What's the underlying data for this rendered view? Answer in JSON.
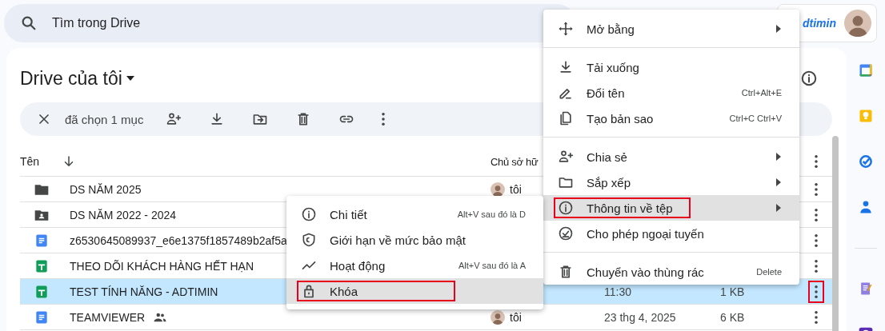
{
  "search": {
    "placeholder": "Tìm trong Drive"
  },
  "account": {
    "logo_text": "dtimin"
  },
  "title": "Drive của tôi",
  "selection_bar": {
    "label": "đã chọn 1 mục"
  },
  "columns": [
    {
      "label": "Tên"
    },
    {
      "label": "Chủ sở hữ"
    }
  ],
  "rows": [
    {
      "kind": "folder",
      "name": "DS NĂM 2025",
      "owner": "tôi",
      "selected": false,
      "more_annotated": false
    },
    {
      "kind": "shared-folder",
      "name": "DS NĂM 2022 - 2024",
      "selected": false,
      "more_annotated": false
    },
    {
      "kind": "doc",
      "name": "z6530645089937_e6e1375f1857489b2af5a",
      "selected": false,
      "more_annotated": false
    },
    {
      "kind": "sheet",
      "name": "THEO DÕI KHÁCH HÀNG HẾT HẠN",
      "selected": false,
      "more_annotated": false
    },
    {
      "kind": "sheet",
      "name": "TEST TÍNH NĂNG - ADTIMIN",
      "date": "11:30",
      "size": "1 KB",
      "selected": true,
      "more_annotated": true
    },
    {
      "kind": "doc",
      "name": "TEAMVIEWER",
      "shared": true,
      "owner": "tôi",
      "date": "23 thg 4, 2025",
      "size": "6 KB",
      "selected": false,
      "more_annotated": false
    }
  ],
  "context_menu": {
    "items": [
      {
        "kind": "item",
        "label": "Mở bằng",
        "submenu": true,
        "selected": false,
        "annotated": false
      },
      {
        "kind": "divider"
      },
      {
        "kind": "item",
        "label": "Tải xuống",
        "submenu": false,
        "selected": false,
        "annotated": false
      },
      {
        "kind": "item",
        "label": "Đổi tên",
        "shortcut": "Ctrl+Alt+E",
        "submenu": false,
        "selected": false,
        "annotated": false
      },
      {
        "kind": "item",
        "label": "Tạo bản sao",
        "shortcut": "Ctrl+C Ctrl+V",
        "submenu": false,
        "selected": false,
        "annotated": false
      },
      {
        "kind": "divider"
      },
      {
        "kind": "item",
        "label": "Chia sẻ",
        "submenu": true,
        "selected": false,
        "annotated": false
      },
      {
        "kind": "item",
        "label": "Sắp xếp",
        "submenu": true,
        "selected": false,
        "annotated": false
      },
      {
        "kind": "item",
        "label": "Thông tin về tệp",
        "submenu": true,
        "selected": true,
        "annotated": true
      },
      {
        "kind": "item",
        "label": "Cho phép ngoại tuyến",
        "submenu": false,
        "selected": false,
        "annotated": false
      },
      {
        "kind": "divider"
      },
      {
        "kind": "item",
        "label": "Chuyển vào thùng rác",
        "shortcut": "Delete",
        "submenu": false,
        "selected": false,
        "annotated": false
      }
    ]
  },
  "submenu": {
    "items": [
      {
        "kind": "item",
        "label": "Chi tiết",
        "shortcut": "Alt+V sau đó là D",
        "selected": false,
        "annotated": false
      },
      {
        "kind": "item",
        "label": "Giới hạn về mức bảo mật",
        "selected": false,
        "annotated": false
      },
      {
        "kind": "item",
        "label": "Hoạt động",
        "shortcut": "Alt+V sau đó là A",
        "selected": false,
        "annotated": false
      },
      {
        "kind": "item",
        "label": "Khóa",
        "selected": true,
        "annotated": true
      }
    ]
  }
}
